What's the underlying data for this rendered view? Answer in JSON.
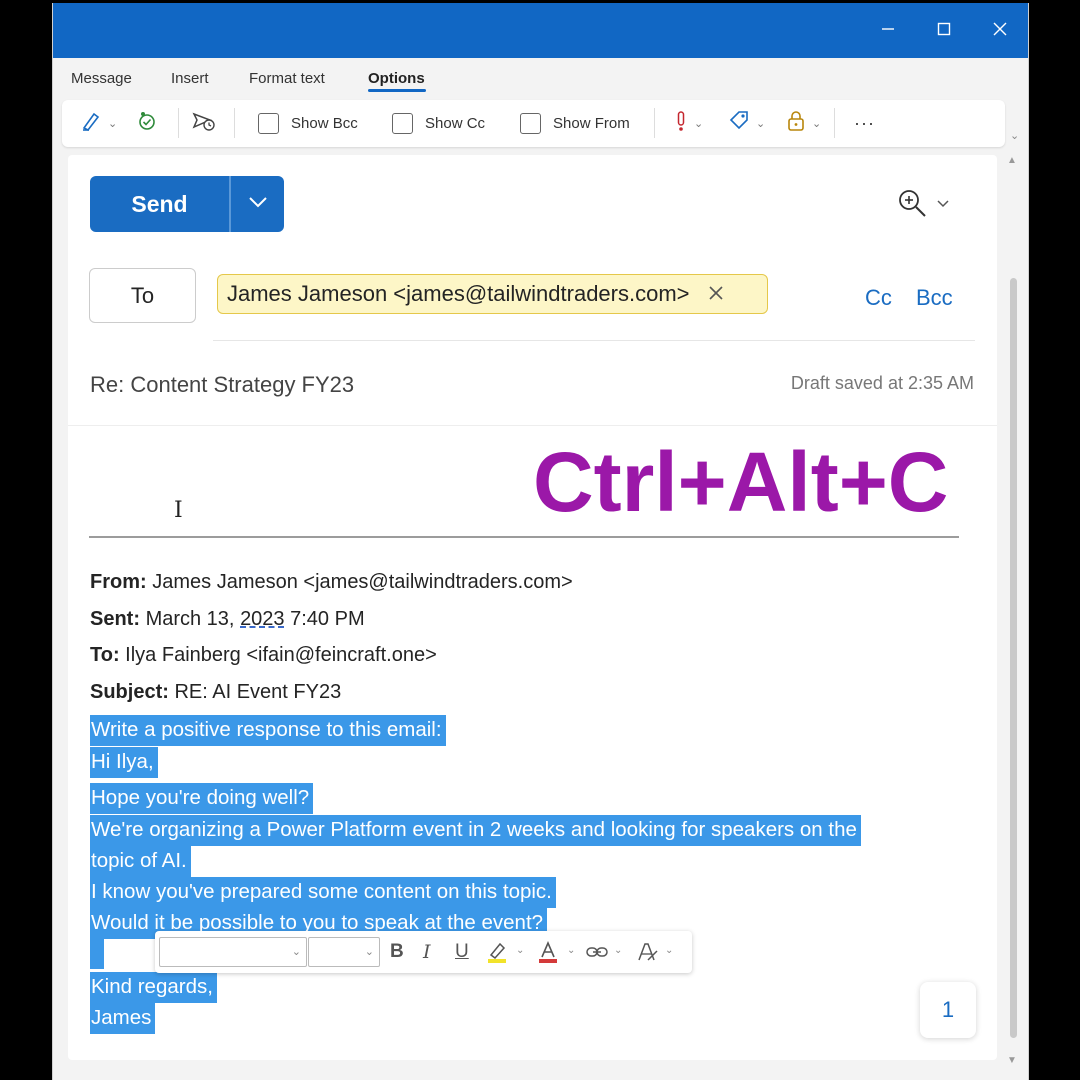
{
  "ribbon_tabs": [
    "Message",
    "Insert",
    "Format text",
    "Options"
  ],
  "active_tab": "Options",
  "ribbon": {
    "show_bcc": "Show Bcc",
    "show_cc": "Show Cc",
    "show_from": "Show From",
    "more": "···"
  },
  "compose": {
    "send_label": "Send",
    "to_label": "To",
    "recipient": "James Jameson <james@tailwindtraders.com>",
    "cc_label": "Cc",
    "bcc_label": "Bcc",
    "subject": "Re: Content Strategy FY23",
    "draft_status": "Draft saved at 2:35 AM"
  },
  "quoted_header": {
    "from_label": "From:",
    "from_value": "James Jameson <james@tailwindtraders.com>",
    "sent_label": "Sent:",
    "sent_date": "March 13,",
    "sent_year": "2023",
    "sent_time": "7:40 PM",
    "to_label": "To:",
    "to_value": "Ilya Fainberg <ifain@feincraft.one>",
    "subject_label": "Subject:",
    "subject_value": "RE: AI Event FY23"
  },
  "selected_lines": [
    "Write a positive response to this email:",
    "Hi Ilya,",
    "Hope you're doing well?",
    "We're organizing a Power Platform event in 2 weeks and looking for speakers on the",
    "topic of AI.",
    "I know you've prepared some content on this topic.",
    "Would it be possible to you to speak at the event?",
    "",
    "Kind regards,",
    "James"
  ],
  "page_count": "1",
  "shortcut_overlay": "Ctrl+Alt+C",
  "colors": {
    "titlebar": "#1167c4",
    "accent": "#1a6cc2",
    "selection": "#3b98e8",
    "recipient_chip": "#fdf6c7",
    "shortcut_text": "#9b18a8"
  }
}
